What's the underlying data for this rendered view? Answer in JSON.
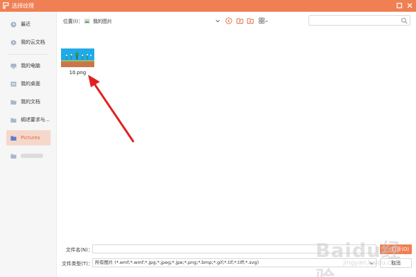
{
  "window": {
    "title": "选择纹理",
    "logo_icon": "wps-logo-icon",
    "accent_color": "#f07f54"
  },
  "sidebar": {
    "items": [
      {
        "label": "最近",
        "icon": "clock-icon"
      },
      {
        "label": "我的云文档",
        "icon": "cloud-doc-icon"
      },
      {
        "label": "我的电脑",
        "icon": "computer-icon"
      },
      {
        "label": "我的桌面",
        "icon": "desktop-icon"
      },
      {
        "label": "我的文档",
        "icon": "folder-icon"
      },
      {
        "label": "纲述要求与...",
        "icon": "folder-icon"
      },
      {
        "label": "Pictures",
        "icon": "folder-icon",
        "active": true
      },
      {
        "label": "",
        "icon": "folder-icon",
        "blurred": true
      }
    ]
  },
  "toolbar": {
    "location_label": "位置(I)：",
    "location_value": "我的图片",
    "search_placeholder": ""
  },
  "files": [
    {
      "name": "10.png"
    }
  ],
  "bottom": {
    "filename_label": "文件名(N)：",
    "filename_value": "",
    "filetype_label": "文件类型(T)：",
    "filetype_value": "所有图片 (*.emf;*.wmf;*.jpg;*.jpeg;*.jpe;*.png;*.bmp;*.gif;*.tif;*.tiff;*.svg)",
    "open_label": "打开(O)",
    "cancel_label": "取消"
  },
  "watermark": {
    "brand": "Baidu经验",
    "sub": "jingyan.baidu.com"
  }
}
